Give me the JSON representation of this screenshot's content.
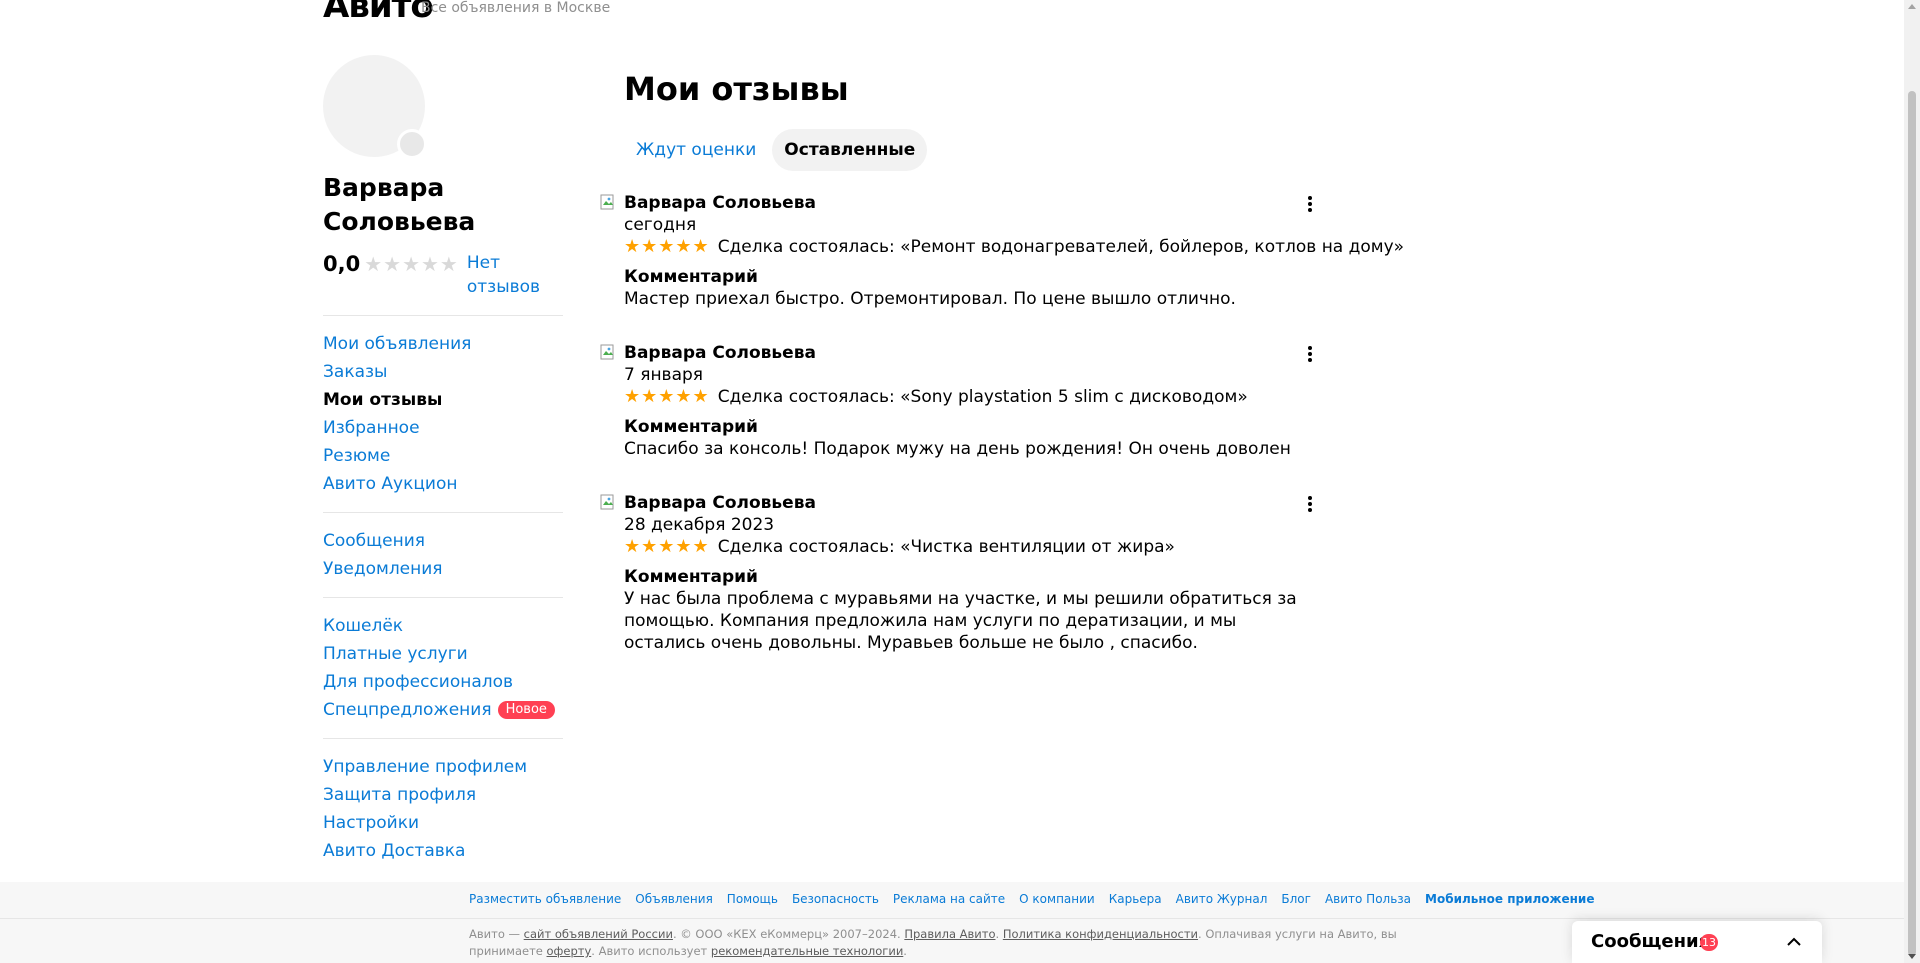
{
  "header": {
    "logo": "Авито",
    "location": "Все объявления в Москве"
  },
  "profile": {
    "name": "Варвара Соловьева",
    "rating": "0,0",
    "stars_empty": "★★★★★",
    "no_reviews": "Нет отзывов"
  },
  "nav": {
    "group1": [
      "Мои объявления",
      "Заказы",
      "Мои отзывы",
      "Избранное",
      "Резюме",
      "Авито Аукцион"
    ],
    "group2": [
      "Сообщения",
      "Уведомления"
    ],
    "group3": [
      "Кошелёк",
      "Платные услуги",
      "Для профессионалов",
      "Спецпредложения"
    ],
    "new_badge": "Новое",
    "group4": [
      "Управление профилем",
      "Защита профиля",
      "Настройки",
      "Авито Доставка"
    ]
  },
  "main": {
    "title": "Мои отзывы",
    "tabs": [
      "Ждут оценки",
      "Оставленные"
    ]
  },
  "reviews": [
    {
      "author": "Варвара Соловьева",
      "date": "сегодня",
      "stars": "★★★★★",
      "deal": "Сделка состоялась: «Ремонт водонагревателей, бойлеров, котлов на дому»",
      "comment_label": "Комментарий",
      "comment": "Мастер приехал быстро. Отремонтировал. По цене вышло отлично."
    },
    {
      "author": "Варвара Соловьева",
      "date": "7 января",
      "stars": "★★★★★",
      "deal": "Сделка состоялась: «Sony playstation 5 slim с дисководом»",
      "comment_label": "Комментарий",
      "comment": "Спасибо за консоль! Подарок мужу на день рождения! Он очень доволен"
    },
    {
      "author": "Варвара Соловьева",
      "date": "28 декабря 2023",
      "stars": "★★★★★",
      "deal": "Сделка состоялась: «Чистка вентиляции от жира»",
      "comment_label": "Комментарий",
      "comment": "У нас была проблема с муравьями на участке, и мы решили обратиться за помощью. Компания предложила нам услуги по дератизации, и мы остались очень довольны. Муравьев больше не было , спасибо."
    }
  ],
  "footer": {
    "links": [
      "Разместить объявление",
      "Объявления",
      "Помощь",
      "Безопасность",
      "Реклама на сайте",
      "О компании",
      "Карьера",
      "Авито Журнал",
      "Блог",
      "Авито Польза",
      "Мобильное приложение"
    ],
    "legal": {
      "p1": "Авито — ",
      "l1": "сайт объявлений России",
      "p2": ". © ООО «КЕХ еКоммерц» 2007–2024. ",
      "l2": "Правила Авито",
      "p3": ". ",
      "l3": "Политика конфиденциальности",
      "p4": ". Оплачивая услуги на Авито, вы принимаете ",
      "l4": "оферту",
      "p5": ". Авито использует ",
      "l5": "рекомендательные технологии",
      "p6": "."
    }
  },
  "messenger": {
    "label": "Сообщения",
    "count": "13"
  },
  "colors": {
    "link": "#0a7bd6",
    "star": "#ffa100",
    "badge": "#ff4053"
  }
}
